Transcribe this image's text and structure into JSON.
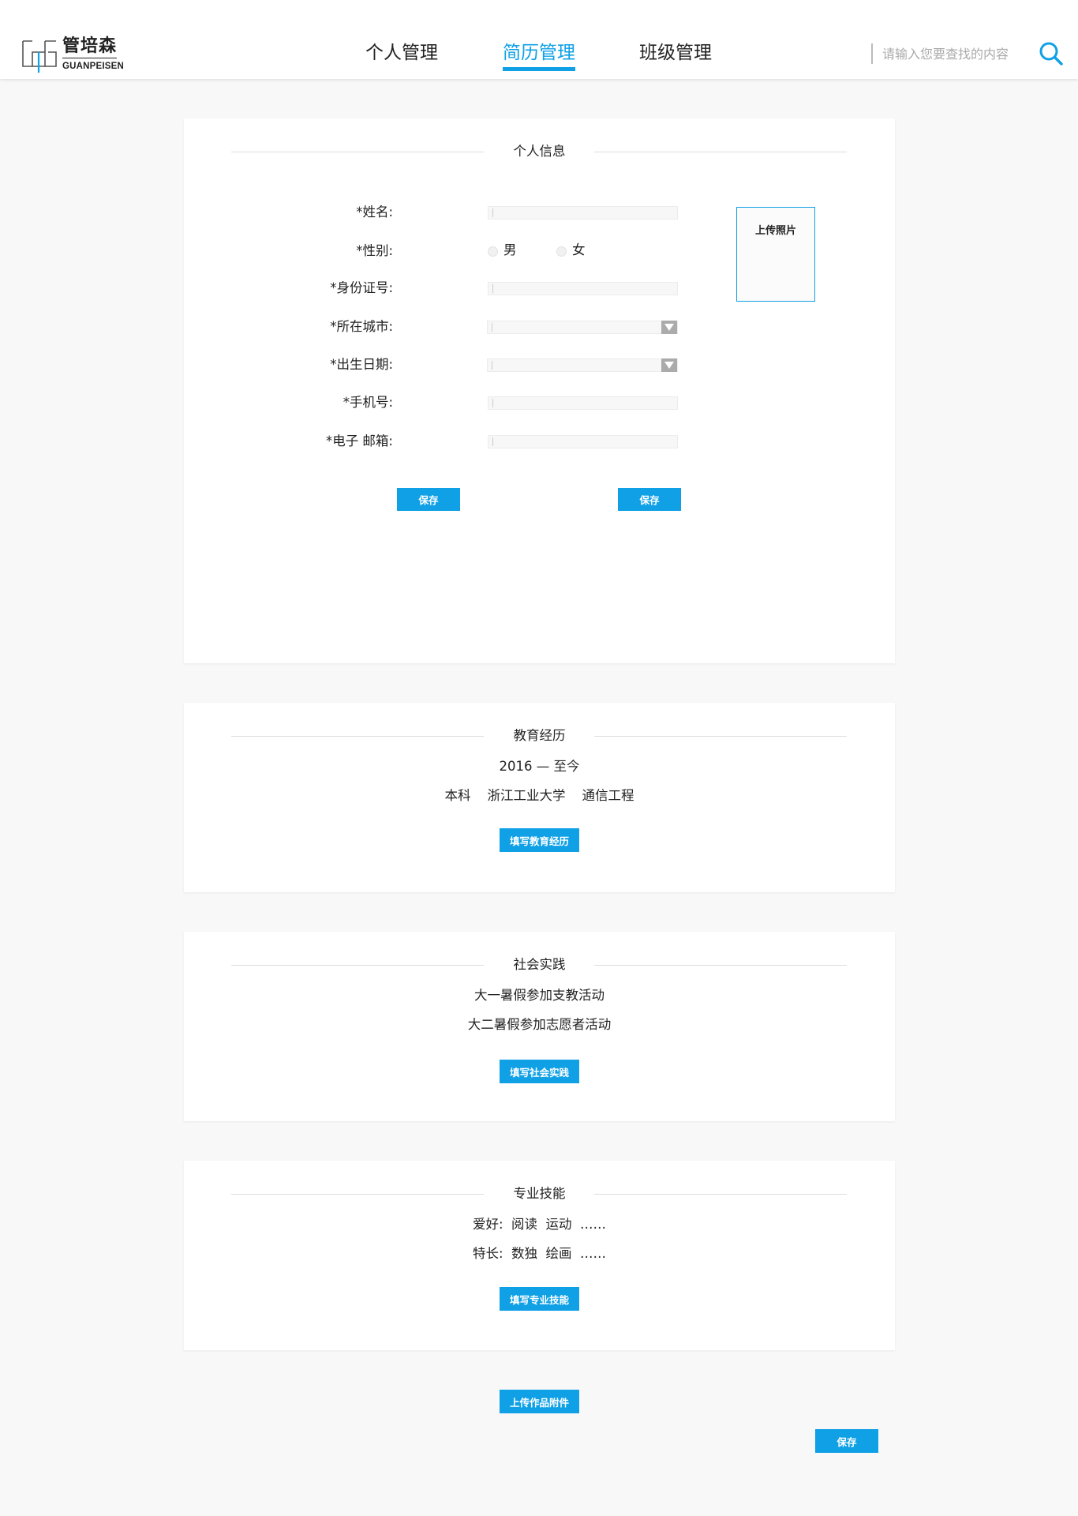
{
  "header": {
    "logo_cn": "管培森",
    "logo_en": "GUANPEISEN",
    "nav": [
      {
        "label": "个人管理",
        "active": false
      },
      {
        "label": "简历管理",
        "active": true
      },
      {
        "label": "班级管理",
        "active": false
      }
    ],
    "search_placeholder": "请输入您要查找的内容"
  },
  "personal": {
    "title": "个人信息",
    "fields": {
      "name": "*姓名:",
      "gender": "*性别:",
      "id_number": "*身份证号:",
      "city": "*所在城市:",
      "birth_date": "*出生日期:",
      "phone": "*手机号:",
      "email": "*电子 邮箱:"
    },
    "gender_options": [
      "男",
      "女"
    ],
    "photo_label": "上传照片",
    "save_left": "保存",
    "save_right": "保存"
  },
  "education": {
    "title": "教育经历",
    "period": "2016 — 至今",
    "detail": "本科    浙江工业大学    通信工程",
    "button": "填写教育经历"
  },
  "social": {
    "title": "社会实践",
    "items": [
      "大一暑假参加支教活动",
      "大二暑假参加志愿者活动"
    ],
    "button": "填写社会实践"
  },
  "skills": {
    "title": "专业技能",
    "hobbies": "爱好:  阅读  运动  ……",
    "specialty": "特长:  数独  绘画  ……",
    "button": "填写专业技能"
  },
  "footer": {
    "upload_button": "上传作品附件",
    "save_button": "保存"
  },
  "colors": {
    "accent": "#0fa0e6",
    "background": "#f8f8f8"
  }
}
